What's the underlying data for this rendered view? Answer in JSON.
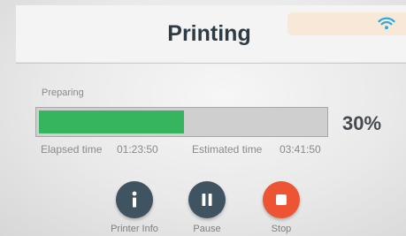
{
  "header": {
    "title": "Printing",
    "wifi_icon": "wifi-icon",
    "wifi_color": "#2aa8e0"
  },
  "job": {
    "status": "Preparing",
    "progress_fraction": 0.3,
    "progress_text": "30%",
    "progress_color": "#36b45e",
    "elapsed_label": "Elapsed time",
    "elapsed_value": "01:23:50",
    "estimated_label": "Estimated time",
    "estimated_value": "03:41:50"
  },
  "actions": {
    "info": {
      "label": "Printer Info",
      "icon": "info-icon",
      "color": "#3f5361"
    },
    "pause": {
      "label": "Pause",
      "icon": "pause-icon",
      "color": "#3f5361"
    },
    "stop": {
      "label": "Stop",
      "icon": "stop-icon",
      "color": "#ec5433"
    }
  }
}
